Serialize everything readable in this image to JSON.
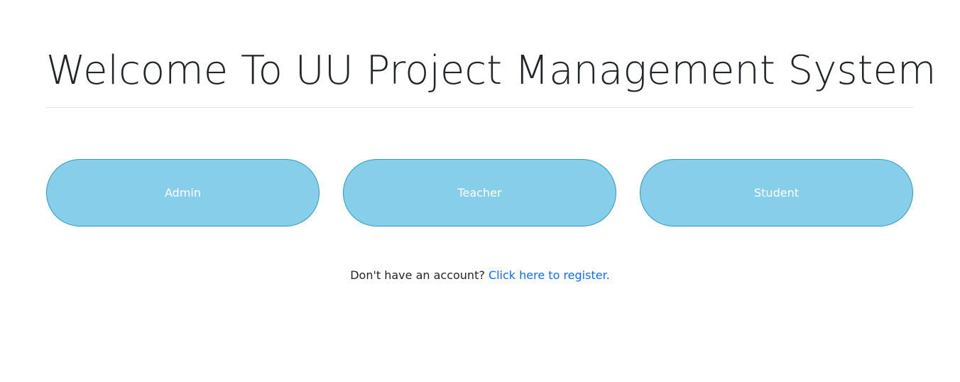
{
  "header": {
    "title": "Welcome To UU Project Management System"
  },
  "roles": {
    "admin_label": "Admin",
    "teacher_label": "Teacher",
    "student_label": "Student"
  },
  "register": {
    "prompt": "Don't have an account?",
    "link_text": "Click here to register."
  },
  "colors": {
    "button_fill": "#87ceeb",
    "button_border": "#2a9bbd",
    "link": "#0d6efd",
    "text": "#212529"
  }
}
